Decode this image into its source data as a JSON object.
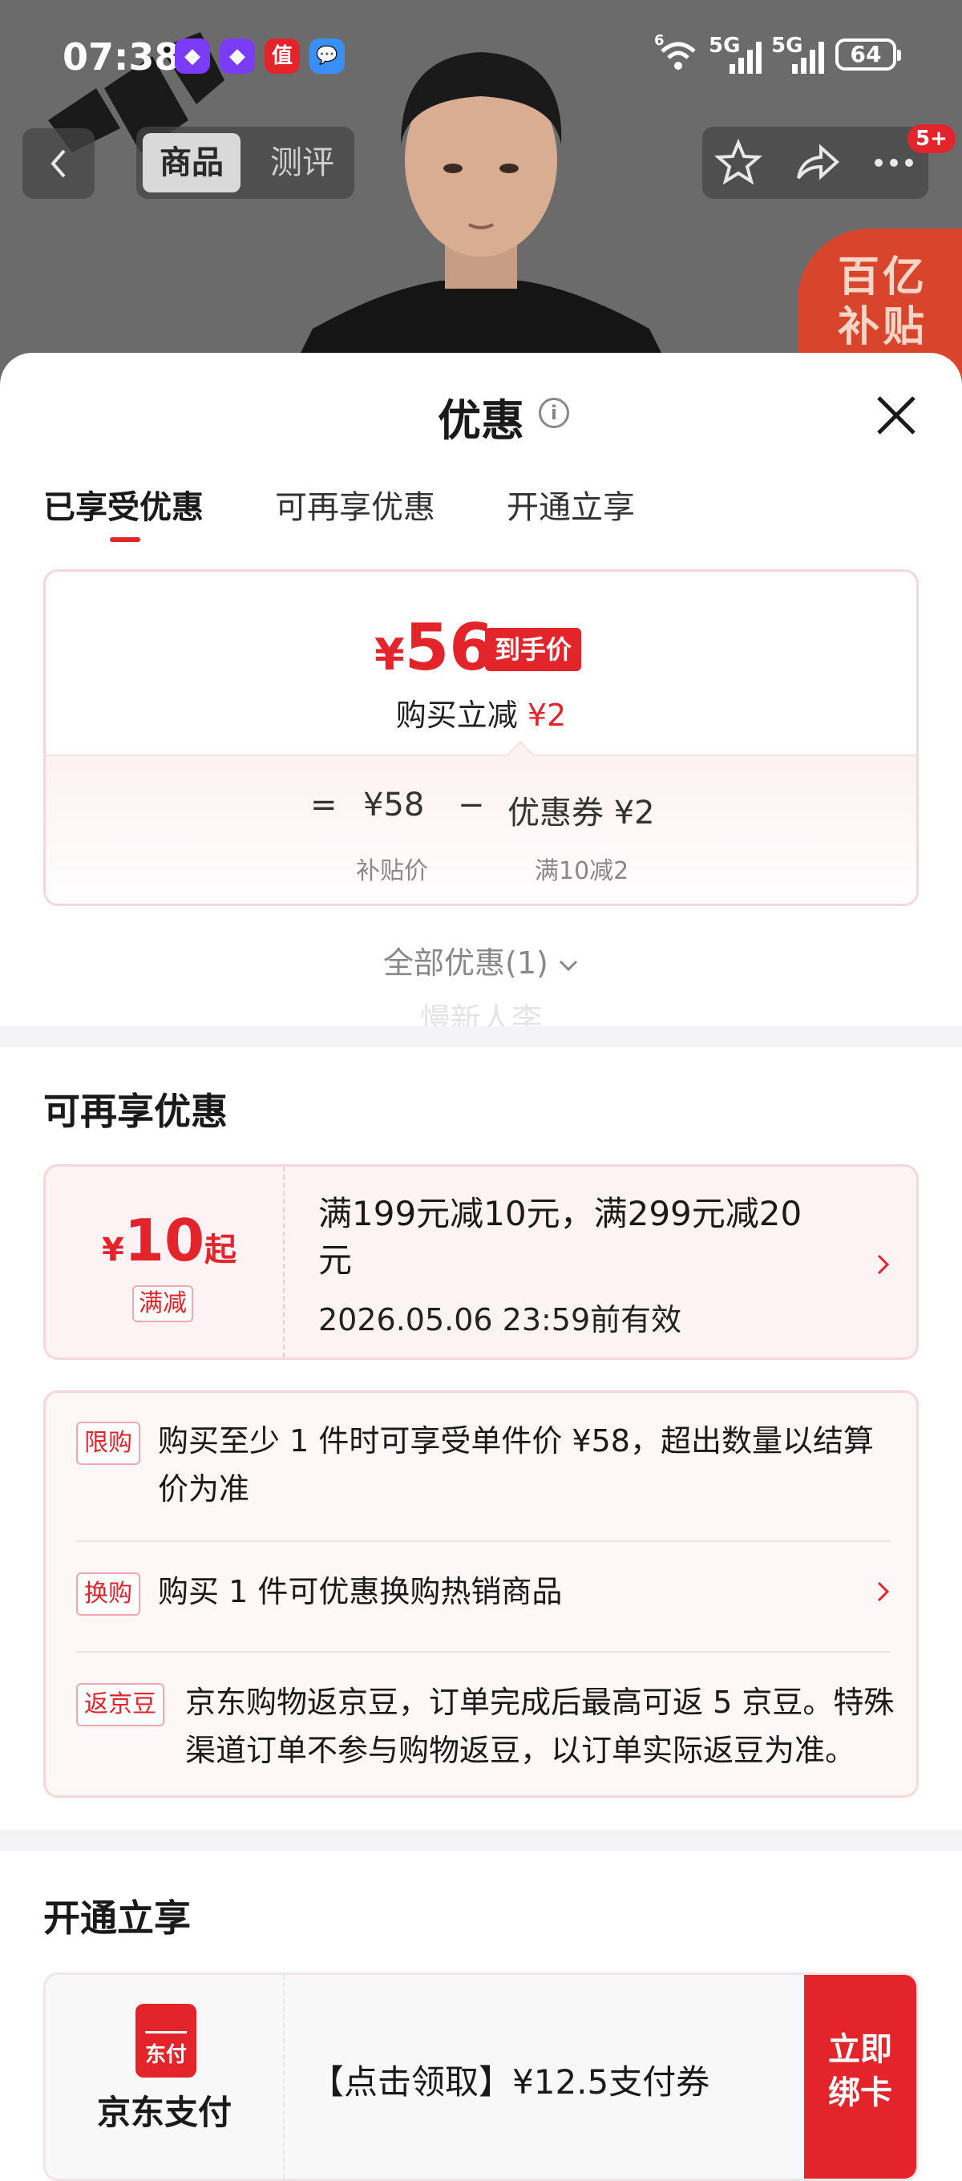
{
  "status_bar": {
    "time": "07:38",
    "app_icons": [
      "◆",
      "◆",
      "值",
      "💬"
    ],
    "signal_1": "6",
    "signal_2": "5G",
    "signal_3": "5G",
    "battery": "64"
  },
  "nav": {
    "tabs": [
      "商品",
      "测评"
    ],
    "cart_badge": "5+"
  },
  "background": {
    "promo_bubble": "百亿\n补贴"
  },
  "sheet": {
    "title": "优惠",
    "tabs": [
      "已享受优惠",
      "可再享优惠",
      "开通立享"
    ],
    "price_card": {
      "yen": "¥",
      "final_price": "56",
      "final_tag": "到手价",
      "instant_label": "购买立减",
      "instant_value": "¥2",
      "eq": "=",
      "base_price": "¥58",
      "minus": "−",
      "coupon_label": "优惠券 ¥2",
      "base_caption": "补贴价",
      "coupon_caption": "满10减2"
    },
    "all_promos": "全部优惠(1)",
    "watermark": "慢新人李",
    "section_more": "可再享优惠",
    "coupon": {
      "yen": "¥",
      "amount": "10",
      "suffix": "起",
      "type": "满减",
      "description": "满199元减10元，满299元减20元",
      "validity": "2026.05.06 23:59前有效"
    },
    "rules": [
      {
        "tag": "限购",
        "text": "购买至少 1 件时可享受单件价 ¥58，超出数量以结算价为准"
      },
      {
        "tag": "换购",
        "text": "购买 1 件可优惠换购热销商品"
      },
      {
        "tag": "返京豆",
        "text": "京东购物返京豆，订单完成后最高可返 5 京豆。特殊渠道订单不参与购物返豆，以订单实际返豆为准。"
      }
    ],
    "section_open": "开通立享",
    "pay": {
      "logo_text": "东付",
      "name": "京东支付",
      "description": "【点击领取】¥12.5支付券",
      "button": "立即\n绑卡"
    }
  },
  "colors": {
    "accent": "#e3242b",
    "card_border": "#f6d8dc",
    "card_bg": "#fdf3f4"
  }
}
